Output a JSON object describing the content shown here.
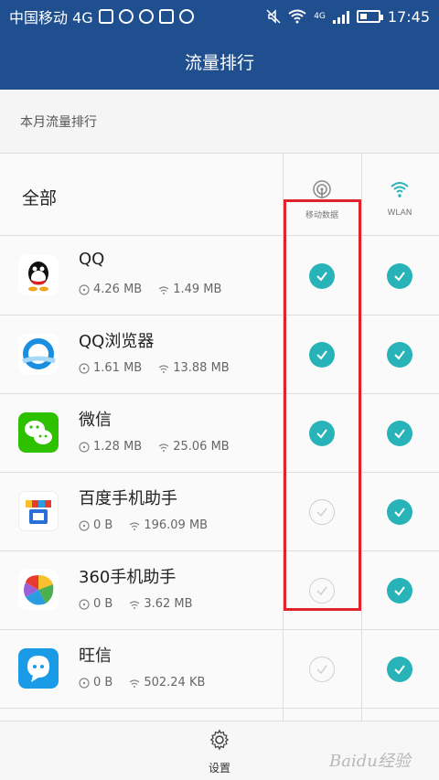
{
  "status_bar": {
    "carrier": "中国移动 4G",
    "time": "17:45",
    "network_badge": "4G"
  },
  "header": {
    "title": "流量排行"
  },
  "section": {
    "label": "本月流量排行"
  },
  "table_header": {
    "all_label": "全部",
    "mobile_label": "移动数据",
    "wlan_label": "WLAN"
  },
  "apps": [
    {
      "name": "QQ",
      "mobile": "4.26 MB",
      "wlan": "1.49 MB",
      "mobile_on": true,
      "wlan_on": true
    },
    {
      "name": "QQ浏览器",
      "mobile": "1.61 MB",
      "wlan": "13.88 MB",
      "mobile_on": true,
      "wlan_on": true
    },
    {
      "name": "微信",
      "mobile": "1.28 MB",
      "wlan": "25.06 MB",
      "mobile_on": true,
      "wlan_on": true
    },
    {
      "name": "百度手机助手",
      "mobile": "0 B",
      "wlan": "196.09 MB",
      "mobile_on": false,
      "wlan_on": true
    },
    {
      "name": "360手机助手",
      "mobile": "0 B",
      "wlan": "3.62 MB",
      "mobile_on": false,
      "wlan_on": true
    },
    {
      "name": "旺信",
      "mobile": "0 B",
      "wlan": "502.24 KB",
      "mobile_on": false,
      "wlan_on": true
    }
  ],
  "bottom": {
    "settings_label": "设置"
  },
  "watermark": "Baidu经验",
  "colors": {
    "accent": "#28b3b8",
    "header_bg": "#1f4f8f",
    "highlight": "#e0232c"
  },
  "icons": [
    "signal-antenna-icon",
    "wifi-icon",
    "check-icon",
    "gear-icon"
  ]
}
